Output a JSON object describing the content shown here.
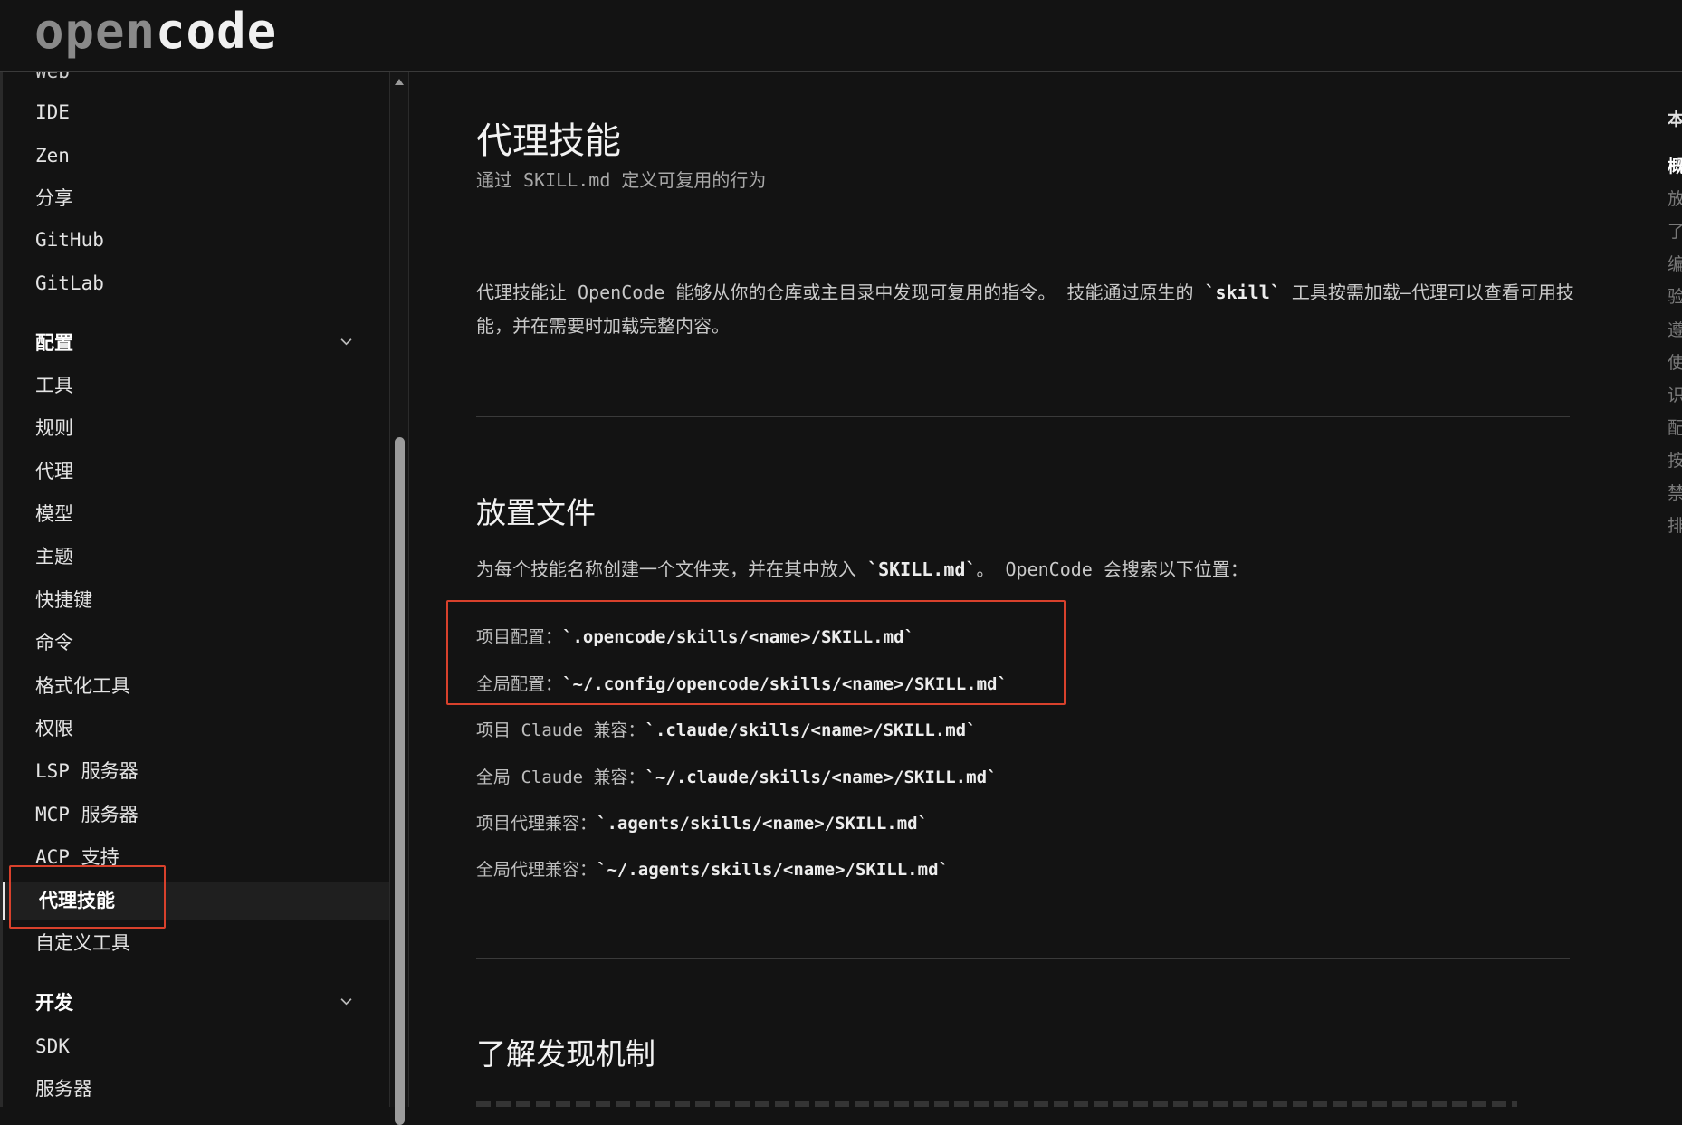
{
  "header": {
    "logo_open": "open",
    "logo_code": "code"
  },
  "sidebar": {
    "cut_item": "Web",
    "items_top": [
      "IDE",
      "Zen",
      "分享",
      "GitHub",
      "GitLab"
    ],
    "group_config": "配置",
    "config_items": [
      "工具",
      "规则",
      "代理",
      "模型",
      "主题",
      "快捷键",
      "命令",
      "格式化工具",
      "权限",
      "LSP 服务器",
      "MCP 服务器",
      "ACP 支持",
      "代理技能",
      "自定义工具"
    ],
    "active_item": "代理技能",
    "group_dev": "开发",
    "dev_items": [
      "SDK",
      "服务器"
    ]
  },
  "main": {
    "title": "代理技能",
    "subtitle": "通过 SKILL.md 定义可复用的行为",
    "intro_pre": "代理技能让 OpenCode 能够从你的仓库或主目录中发现可复用的指令。 技能通过原生的 ",
    "intro_code": "`skill`",
    "intro_post": " 工具按需加载—代理可以查看可用技能，并在需要时加载完整内容。",
    "section1_title": "放置文件",
    "section1_desc_pre": "为每个技能名称创建一个文件夹，并在其中放入 ",
    "section1_desc_code": "`SKILL.md`",
    "section1_desc_post": "。 OpenCode 会搜索以下位置：",
    "locations": [
      {
        "label": "项目配置：",
        "path": "`.opencode/skills/<name>/SKILL.md`"
      },
      {
        "label": "全局配置：",
        "path": "`~/.config/opencode/skills/<name>/SKILL.md`"
      },
      {
        "label": "项目 Claude 兼容：",
        "path": "`.claude/skills/<name>/SKILL.md`"
      },
      {
        "label": "全局 Claude 兼容：",
        "path": "`~/.claude/skills/<name>/SKILL.md`"
      },
      {
        "label": "项目代理兼容：",
        "path": "`.agents/skills/<name>/SKILL.md`"
      },
      {
        "label": "全局代理兼容：",
        "path": "`~/.agents/skills/<name>/SKILL.md`"
      }
    ],
    "section2_title": "了解发现机制"
  },
  "toc": {
    "items": [
      "本",
      "概",
      "放",
      "了",
      "编",
      "验",
      "遵",
      "使",
      "识",
      "配",
      "按",
      "禁",
      "排"
    ]
  },
  "colors": {
    "background": "#131313",
    "highlight": "#d8412c",
    "active_row": "#1f1f1f"
  }
}
